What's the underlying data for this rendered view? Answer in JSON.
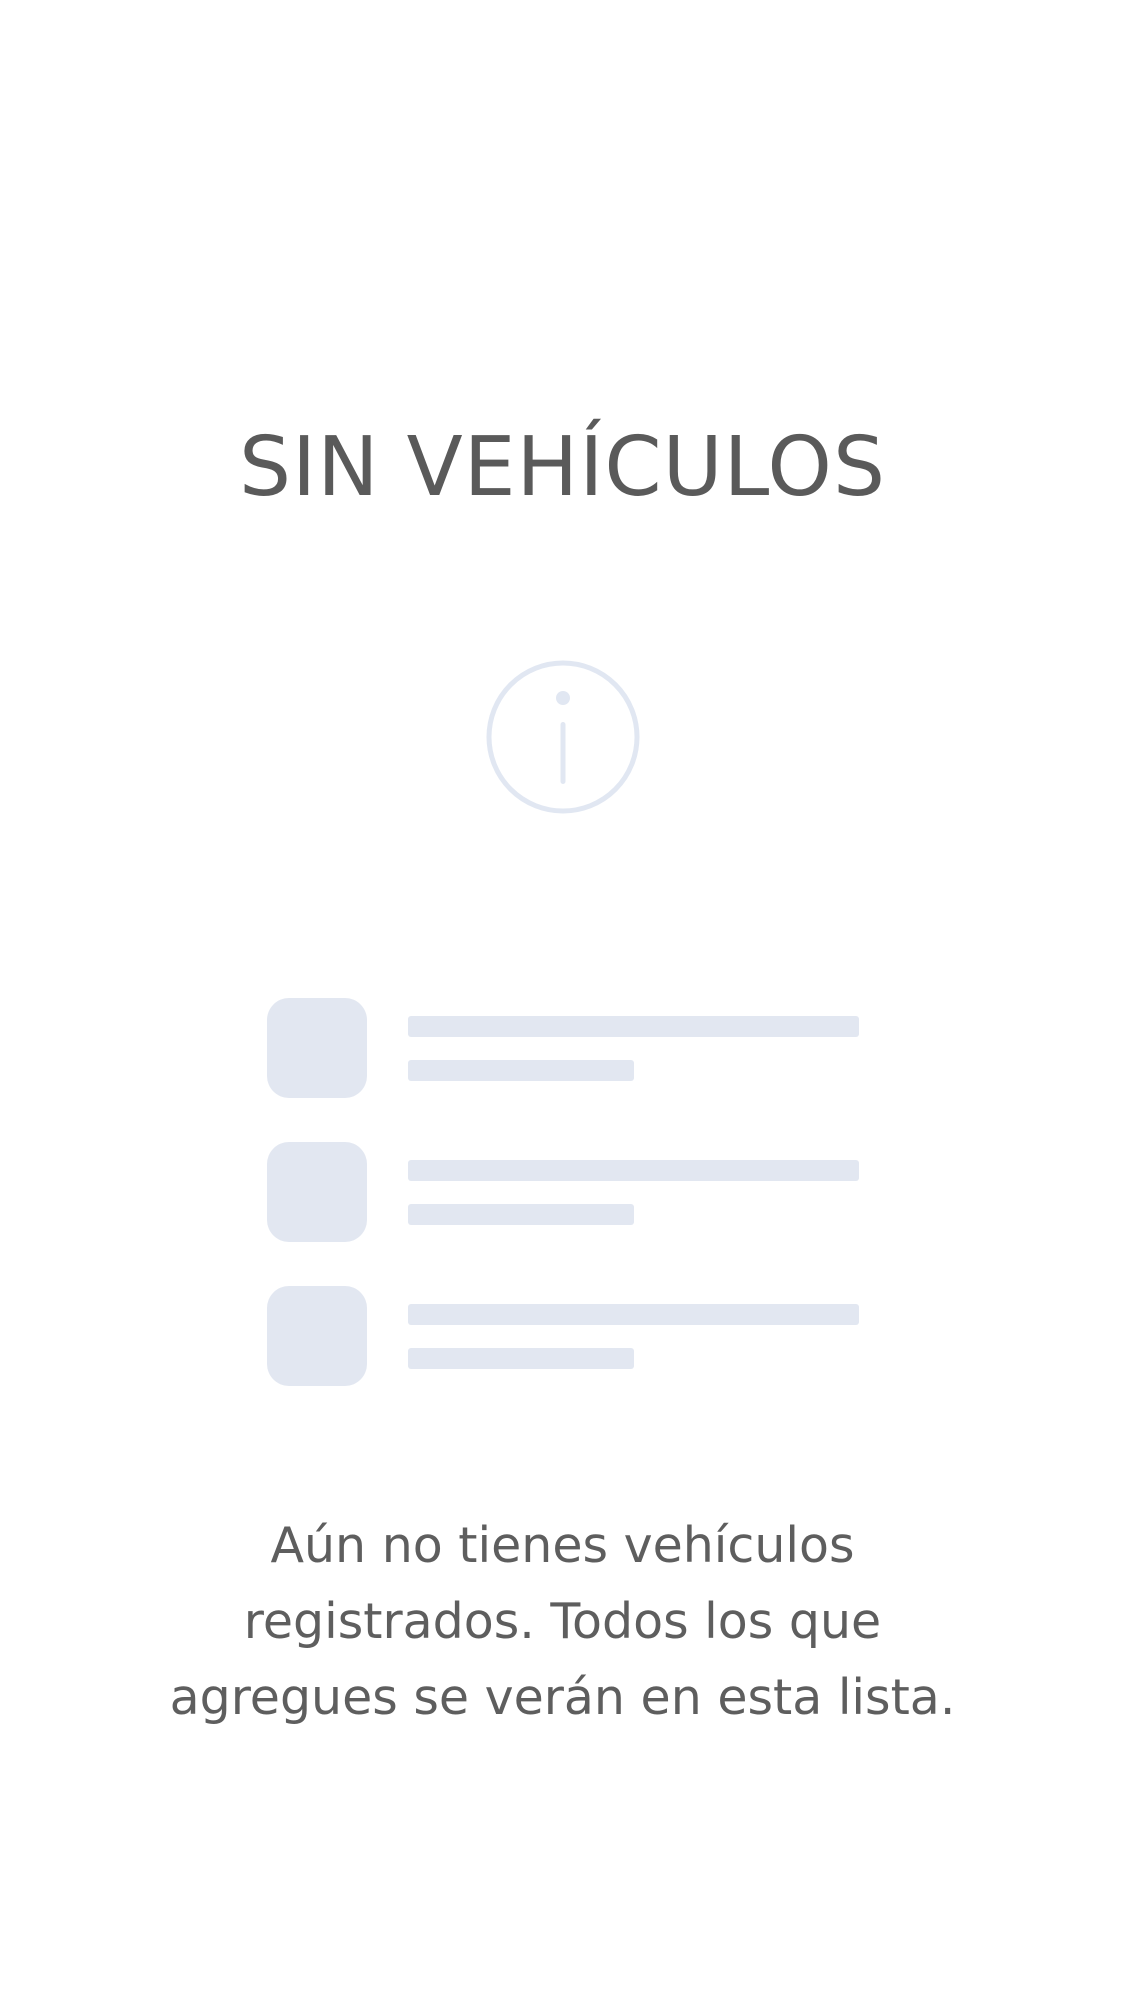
{
  "empty_state": {
    "title": "SIN VEHÍCULOS",
    "icon": "info-circle-icon",
    "placeholder_rows": 3,
    "message_lines": [
      "Aún no tienes vehículos",
      "registrados. Todos los que",
      "agregues se verán en esta lista."
    ]
  },
  "colors": {
    "title_text": "#5a5a5a",
    "body_text": "#5e5e5e",
    "icon_stroke": "#e1e7f2",
    "skeleton": "#e2e7f1",
    "background": "#ffffff"
  }
}
